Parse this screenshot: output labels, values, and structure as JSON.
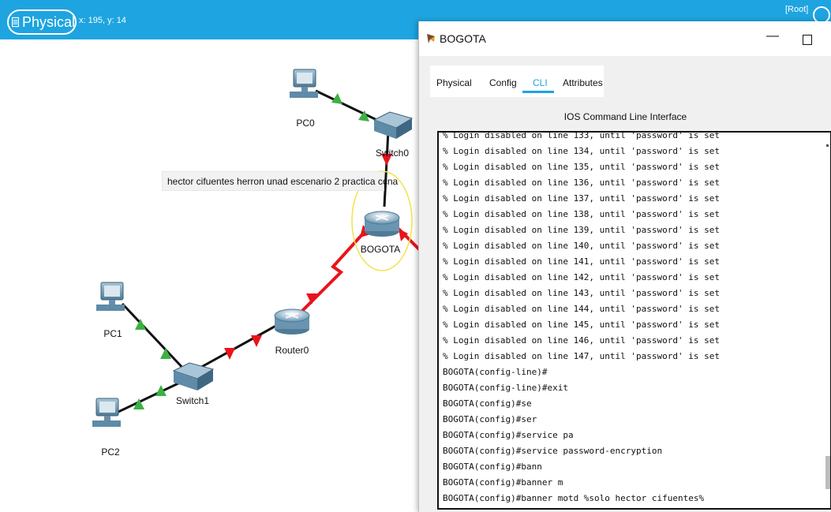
{
  "topbar": {
    "view_label": "Physical",
    "coords": "x: 195, y: 14",
    "root_label": "[Root]"
  },
  "topology": {
    "devices": {
      "pc0": "PC0",
      "switch0": "Switch0",
      "bogota": "BOGOTA",
      "router0": "Router0",
      "pc1": "PC1",
      "switch1": "Switch1",
      "pc2": "PC2"
    },
    "note": "hector cifuentes herron unad escenario 2 practica ccna",
    "colors": {
      "link": "#111111",
      "serial": "#e8141c",
      "up": "#3cb043",
      "down": "#e8141c",
      "device": "#5e8ba8"
    }
  },
  "window": {
    "title": "BOGOTA",
    "tabs": [
      "Physical",
      "Config",
      "CLI",
      "Attributes"
    ],
    "active_tab": "CLI",
    "heading": "IOS Command Line Interface",
    "console_lines": [
      "% Login disabled on line 133, until 'password' is set",
      "% Login disabled on line 134, until 'password' is set",
      "% Login disabled on line 135, until 'password' is set",
      "% Login disabled on line 136, until 'password' is set",
      "% Login disabled on line 137, until 'password' is set",
      "% Login disabled on line 138, until 'password' is set",
      "% Login disabled on line 139, until 'password' is set",
      "% Login disabled on line 140, until 'password' is set",
      "% Login disabled on line 141, until 'password' is set",
      "% Login disabled on line 142, until 'password' is set",
      "% Login disabled on line 143, until 'password' is set",
      "% Login disabled on line 144, until 'password' is set",
      "% Login disabled on line 145, until 'password' is set",
      "% Login disabled on line 146, until 'password' is set",
      "% Login disabled on line 147, until 'password' is set",
      "BOGOTA(config-line)#",
      "BOGOTA(config-line)#exit",
      "BOGOTA(config)#se",
      "BOGOTA(config)#ser",
      "BOGOTA(config)#service pa",
      "BOGOTA(config)#service password-encryption",
      "BOGOTA(config)#bann",
      "BOGOTA(config)#banner m",
      "BOGOTA(config)#banner motd %solo hector cifuentes%"
    ]
  }
}
